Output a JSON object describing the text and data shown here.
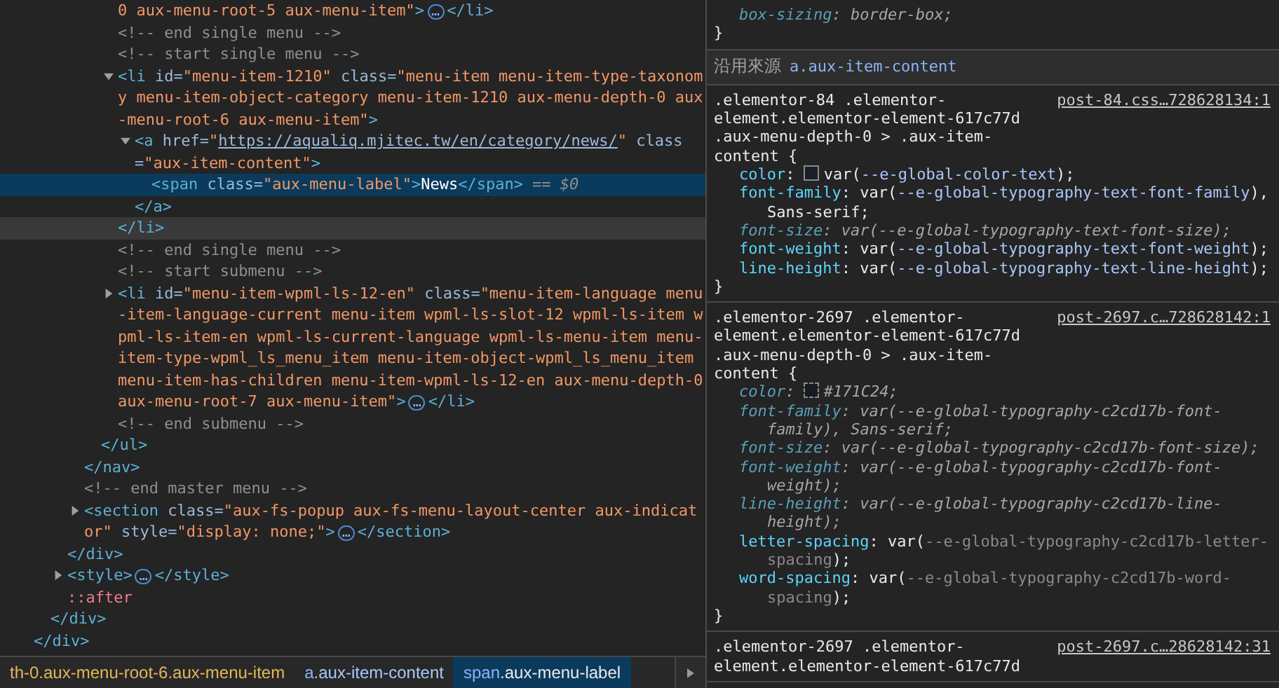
{
  "elements_panel": {
    "tree": [
      {
        "close": [
          {
            "kind": "tag",
            "text": "</div>"
          }
        ],
        "close_hovered": false,
        "children": [
          {
            "close": [
              {
                "kind": "tag",
                "text": "</div>"
              }
            ],
            "close_hovered": false,
            "children": [
              {
                "close": [
                  {
                    "kind": "tag",
                    "text": "</div>"
                  }
                ],
                "close_hovered": false,
                "children": [
                  {
                    "close": [
                      {
                        "kind": "tag",
                        "text": "</nav>"
                      }
                    ],
                    "close_hovered": false,
                    "children": [
                      {
                        "close": [
                          {
                            "kind": "tag",
                            "text": "</ul>"
                          }
                        ],
                        "close_hovered": false,
                        "children": [
                          {
                            "selected": false,
                            "open": [
                              {
                                "kind": "value",
                                "text": "0 aux-menu-root-5 aux-menu-item\""
                              },
                              {
                                "kind": "tag",
                                "text": ">"
                              },
                              {
                                "kind": "ellipsis",
                                "text": "…"
                              },
                              {
                                "kind": "tag",
                                "text": "</li>"
                              }
                            ]
                          },
                          {
                            "selected": false,
                            "open": [
                              {
                                "kind": "comment",
                                "text": "<!-- end single menu -->"
                              }
                            ]
                          },
                          {
                            "selected": false,
                            "open": [
                              {
                                "kind": "comment",
                                "text": "<!-- start single menu -->"
                              }
                            ]
                          },
                          {
                            "selected": false,
                            "expanded": true,
                            "open": [
                              {
                                "kind": "tag",
                                "text": "<li"
                              },
                              {
                                "kind": "attr",
                                "text": " id="
                              },
                              {
                                "kind": "value",
                                "text": "\"menu-item-1210\""
                              },
                              {
                                "kind": "attr",
                                "text": " class="
                              },
                              {
                                "kind": "value",
                                "text": "\"menu-item menu-item-type-taxonomy menu-item-object-category menu-item-1210 aux-menu-depth-0 aux-menu-root-6 aux-menu-item\""
                              },
                              {
                                "kind": "tag",
                                "text": ">"
                              }
                            ],
                            "close": [
                              {
                                "kind": "tag",
                                "text": "</li>"
                              }
                            ],
                            "close_hovered": true,
                            "children": [
                              {
                                "selected": false,
                                "expanded": true,
                                "open": [
                                  {
                                    "kind": "tag",
                                    "text": "<a"
                                  },
                                  {
                                    "kind": "attr",
                                    "text": " href="
                                  },
                                  {
                                    "kind": "value",
                                    "text": "\""
                                  },
                                  {
                                    "kind": "link",
                                    "text": "https://aqualiq.mjitec.tw/en/category/news/"
                                  },
                                  {
                                    "kind": "value",
                                    "text": "\""
                                  },
                                  {
                                    "kind": "attr",
                                    "text": " class="
                                  },
                                  {
                                    "kind": "value",
                                    "text": "\"aux-item-content\""
                                  },
                                  {
                                    "kind": "tag",
                                    "text": ">"
                                  }
                                ],
                                "close": [
                                  {
                                    "kind": "tag",
                                    "text": "</a>"
                                  }
                                ],
                                "close_hovered": false,
                                "children": [
                                  {
                                    "selected": true,
                                    "open": [
                                      {
                                        "kind": "tag",
                                        "text": "<span"
                                      },
                                      {
                                        "kind": "attr",
                                        "text": " class="
                                      },
                                      {
                                        "kind": "value",
                                        "text": "\"aux-menu-label\""
                                      },
                                      {
                                        "kind": "tag",
                                        "text": ">"
                                      },
                                      {
                                        "kind": "text",
                                        "text": "News"
                                      },
                                      {
                                        "kind": "tag",
                                        "text": "</span>"
                                      },
                                      {
                                        "kind": "console",
                                        "text": " == $0"
                                      }
                                    ]
                                  }
                                ]
                              }
                            ]
                          },
                          {
                            "selected": false,
                            "open": [
                              {
                                "kind": "comment",
                                "text": "<!-- end single menu -->"
                              }
                            ]
                          },
                          {
                            "selected": false,
                            "open": [
                              {
                                "kind": "comment",
                                "text": "<!-- start submenu -->"
                              }
                            ]
                          },
                          {
                            "selected": false,
                            "expanded": false,
                            "open": [
                              {
                                "kind": "tag",
                                "text": "<li"
                              },
                              {
                                "kind": "attr",
                                "text": " id="
                              },
                              {
                                "kind": "value",
                                "text": "\"menu-item-wpml-ls-12-en\""
                              },
                              {
                                "kind": "attr",
                                "text": " class="
                              },
                              {
                                "kind": "value",
                                "text": "\"menu-item-language menu-item-language-current menu-item wpml-ls-slot-12 wpml-ls-item wpml-ls-item-en wpml-ls-current-language wpml-ls-menu-item menu-item-type-wpml_ls_menu_item menu-item-object-wpml_ls_menu_item menu-item-has-children menu-item-wpml-ls-12-en aux-menu-depth-0 aux-menu-root-7 aux-menu-item\""
                              },
                              {
                                "kind": "tag",
                                "text": ">"
                              },
                              {
                                "kind": "ellipsis",
                                "text": "…"
                              },
                              {
                                "kind": "tag",
                                "text": "</li>"
                              }
                            ]
                          },
                          {
                            "selected": false,
                            "open": [
                              {
                                "kind": "comment",
                                "text": "<!-- end submenu -->"
                              }
                            ]
                          }
                        ]
                      }
                    ]
                  },
                  {
                    "selected": false,
                    "open": [
                      {
                        "kind": "comment",
                        "text": "<!-- end master menu -->"
                      }
                    ]
                  },
                  {
                    "selected": false,
                    "expanded": false,
                    "open": [
                      {
                        "kind": "tag",
                        "text": "<section"
                      },
                      {
                        "kind": "attr",
                        "text": " class="
                      },
                      {
                        "kind": "value",
                        "text": "\"aux-fs-popup aux-fs-menu-layout-center aux-indicator\""
                      },
                      {
                        "kind": "attr",
                        "text": " style="
                      },
                      {
                        "kind": "value",
                        "text": "\"display: none;\""
                      },
                      {
                        "kind": "tag",
                        "text": ">"
                      },
                      {
                        "kind": "ellipsis",
                        "text": "…"
                      },
                      {
                        "kind": "tag",
                        "text": "</section>"
                      }
                    ]
                  }
                ]
              },
              {
                "selected": false,
                "expanded": false,
                "open": [
                  {
                    "kind": "tag",
                    "text": "<style>"
                  },
                  {
                    "kind": "ellipsis",
                    "text": "…"
                  },
                  {
                    "kind": "tag",
                    "text": "</style>"
                  }
                ]
              },
              {
                "selected": false,
                "open": [
                  {
                    "kind": "pseudo",
                    "text": "::after"
                  }
                ]
              }
            ]
          }
        ]
      }
    ],
    "breadcrumbs": [
      {
        "classes": "th-0.aux-menu-root-6.aux-menu-item",
        "selected": false
      },
      {
        "tag": "a",
        "classes": ".aux-item-content",
        "selected": false
      },
      {
        "tag": "span",
        "classes": ".aux-menu-label",
        "selected": true
      }
    ]
  },
  "styles_panel": {
    "sections": [
      {
        "kind": "rule",
        "declarations": [
          {
            "property": "box-sizing",
            "overridden": true,
            "value": [
              {
                "kind": "plain",
                "text": ": border-box;"
              }
            ]
          }
        ],
        "close": "}"
      },
      {
        "kind": "inherited-header",
        "label": "沿用來源",
        "selector": "a.aux-item-content"
      },
      {
        "kind": "rule",
        "selector": ".elementor-84 .elementor-element.elementor-element-617c77d .aux-menu-depth-0 > .aux-item-content {",
        "source": "post-84.css…728628134:1",
        "declarations": [
          {
            "property": "color",
            "overridden": false,
            "value": [
              {
                "kind": "plain",
                "text": ": "
              },
              {
                "kind": "swatch",
                "color": "#1b1f27"
              },
              {
                "kind": "plain",
                "text": "var("
              },
              {
                "kind": "var",
                "text": "--e-global-color-text"
              },
              {
                "kind": "plain",
                "text": ");"
              }
            ]
          },
          {
            "property": "font-family",
            "overridden": false,
            "value": [
              {
                "kind": "plain",
                "text": ": var("
              },
              {
                "kind": "var",
                "text": "--e-global-typography-text-font-family"
              },
              {
                "kind": "plain",
                "text": "), Sans-serif;"
              }
            ]
          },
          {
            "property": "font-size",
            "overridden": true,
            "value": [
              {
                "kind": "plain",
                "text": ": var("
              },
              {
                "kind": "var",
                "text": "--e-global-typography-text-font-size"
              },
              {
                "kind": "plain",
                "text": ");"
              }
            ]
          },
          {
            "property": "font-weight",
            "overridden": false,
            "value": [
              {
                "kind": "plain",
                "text": ": var("
              },
              {
                "kind": "var",
                "text": "--e-global-typography-text-font-weight"
              },
              {
                "kind": "plain",
                "text": ");"
              }
            ]
          },
          {
            "property": "line-height",
            "overridden": false,
            "value": [
              {
                "kind": "plain",
                "text": ": var("
              },
              {
                "kind": "var",
                "text": "--e-global-typography-text-line-height"
              },
              {
                "kind": "plain",
                "text": ");"
              }
            ]
          }
        ],
        "close": "}"
      },
      {
        "kind": "rule",
        "selector": ".elementor-2697 .elementor-element.elementor-element-617c77d .aux-menu-depth-0 > .aux-item-content {",
        "source": "post-2697.c…728628142:1",
        "declarations": [
          {
            "property": "color",
            "overridden": true,
            "value": [
              {
                "kind": "plain",
                "text": ": "
              },
              {
                "kind": "swatch",
                "color": "#171c24"
              },
              {
                "kind": "plain",
                "text": "#171C24;"
              }
            ]
          },
          {
            "property": "font-family",
            "overridden": true,
            "value": [
              {
                "kind": "plain",
                "text": ": var("
              },
              {
                "kind": "var",
                "text": "--e-global-typography-c2cd17b-font-family"
              },
              {
                "kind": "plain",
                "text": "), Sans-serif;"
              }
            ]
          },
          {
            "property": "font-size",
            "overridden": true,
            "value": [
              {
                "kind": "plain",
                "text": ": var("
              },
              {
                "kind": "var",
                "text": "--e-global-typography-c2cd17b-font-size"
              },
              {
                "kind": "plain",
                "text": ");"
              }
            ]
          },
          {
            "property": "font-weight",
            "overridden": true,
            "value": [
              {
                "kind": "plain",
                "text": ": var("
              },
              {
                "kind": "var",
                "text": "--e-global-typography-c2cd17b-font-weight"
              },
              {
                "kind": "plain",
                "text": ");"
              }
            ]
          },
          {
            "property": "line-height",
            "overridden": true,
            "value": [
              {
                "kind": "plain",
                "text": ": var("
              },
              {
                "kind": "var",
                "text": "--e-global-typography-c2cd17b-line-height"
              },
              {
                "kind": "plain",
                "text": ");"
              }
            ]
          },
          {
            "property": "letter-spacing",
            "overridden": false,
            "value": [
              {
                "kind": "plain",
                "text": ": var("
              },
              {
                "kind": "undefined-var",
                "text": "--e-global-typography-c2cd17b-letter-spacing"
              },
              {
                "kind": "plain",
                "text": ");"
              }
            ]
          },
          {
            "property": "word-spacing",
            "overridden": false,
            "value": [
              {
                "kind": "plain",
                "text": ": var("
              },
              {
                "kind": "undefined-var",
                "text": "--e-global-typography-c2cd17b-word-spacing"
              },
              {
                "kind": "plain",
                "text": ");"
              }
            ]
          }
        ],
        "close": "}"
      },
      {
        "kind": "rule",
        "selector": ".elementor-2697 .elementor-element.elementor-element-617c77d",
        "source": "post-2697.c…28628142:31"
      }
    ]
  }
}
